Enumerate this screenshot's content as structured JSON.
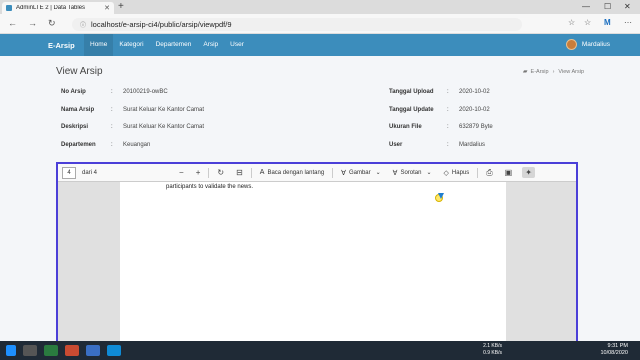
{
  "browser": {
    "tab_title": "AdminLTE 2 | Data Tables",
    "url": "localhost/e-arsip-ci4/public/arsip/viewpdf/9"
  },
  "navbar": {
    "brand": "E-Arsip",
    "menu": [
      {
        "label": "Home"
      },
      {
        "label": "Kategori"
      },
      {
        "label": "Departemen"
      },
      {
        "label": "Arsip"
      },
      {
        "label": "User"
      }
    ],
    "user_name": "Mardalius"
  },
  "page": {
    "title": "View Arsip",
    "breadcrumb": [
      "E-Arsip",
      "View Arsip"
    ]
  },
  "details_left": [
    {
      "label": "No Arsip",
      "value": "20100219-owBC"
    },
    {
      "label": "Nama Arsip",
      "value": "Surat Keluar Ke Kantor Camat"
    },
    {
      "label": "Deskripsi",
      "value": "Surat Keluar Ke Kantor Camat"
    },
    {
      "label": "Departemen",
      "value": "Keuangan"
    }
  ],
  "details_right": [
    {
      "label": "Tanggal Upload",
      "value": "2020-10-02"
    },
    {
      "label": "Tanggal Update",
      "value": "2020-10-02"
    },
    {
      "label": "Ukuran File",
      "value": "632879 Byte"
    },
    {
      "label": "User",
      "value": "Mardalius"
    }
  ],
  "pdf_viewer": {
    "page_number": "4",
    "page_count": "dari 4",
    "read_aloud": "Baca dengan lantang",
    "draw": "Gambar",
    "highlight": "Sorotan",
    "erase": "Hapus",
    "page_text": "participants to validate the news."
  },
  "taskbar": {
    "net_up": "2.1 KB/s",
    "net_down": "0.9 KB/s",
    "time": "9:31 PM",
    "date": "10/08/2020"
  }
}
